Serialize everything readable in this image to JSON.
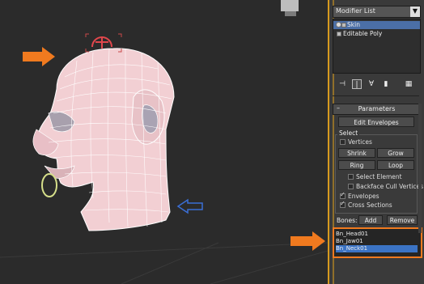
{
  "modifier_list": {
    "label": "Modifier List"
  },
  "stack": {
    "items": [
      {
        "label": "Skin",
        "selected": true
      },
      {
        "label": "Editable Poly",
        "selected": false
      }
    ]
  },
  "toolbar": {
    "icons": [
      "pin-stack-icon",
      "show-end-result-icon",
      "make-unique-icon",
      "remove-modifier-icon",
      "configure-sets-icon"
    ]
  },
  "parameters": {
    "title": "Parameters",
    "edit_envelopes": "Edit Envelopes",
    "select_group": "Select",
    "vertices": "Vertices",
    "shrink": "Shrink",
    "grow": "Grow",
    "ring": "Ring",
    "loop": "Loop",
    "select_element": "Select Element",
    "backface_cull": "Backface Cull Vertices",
    "envelopes": "Envelopes",
    "cross_sections": "Cross Sections",
    "bones_label": "Bones:",
    "add": "Add",
    "remove": "Remove"
  },
  "bones": [
    {
      "label": "Bn_Head01",
      "selected": false
    },
    {
      "label": "Bn_Jaw01",
      "selected": false
    },
    {
      "label": "Bn_Neck01",
      "selected": true
    }
  ],
  "colors": {
    "accent": "#f07a1f",
    "selection": "#3b73c4",
    "panel_border": "#d79a1e",
    "mesh": "#f0d0d3"
  }
}
